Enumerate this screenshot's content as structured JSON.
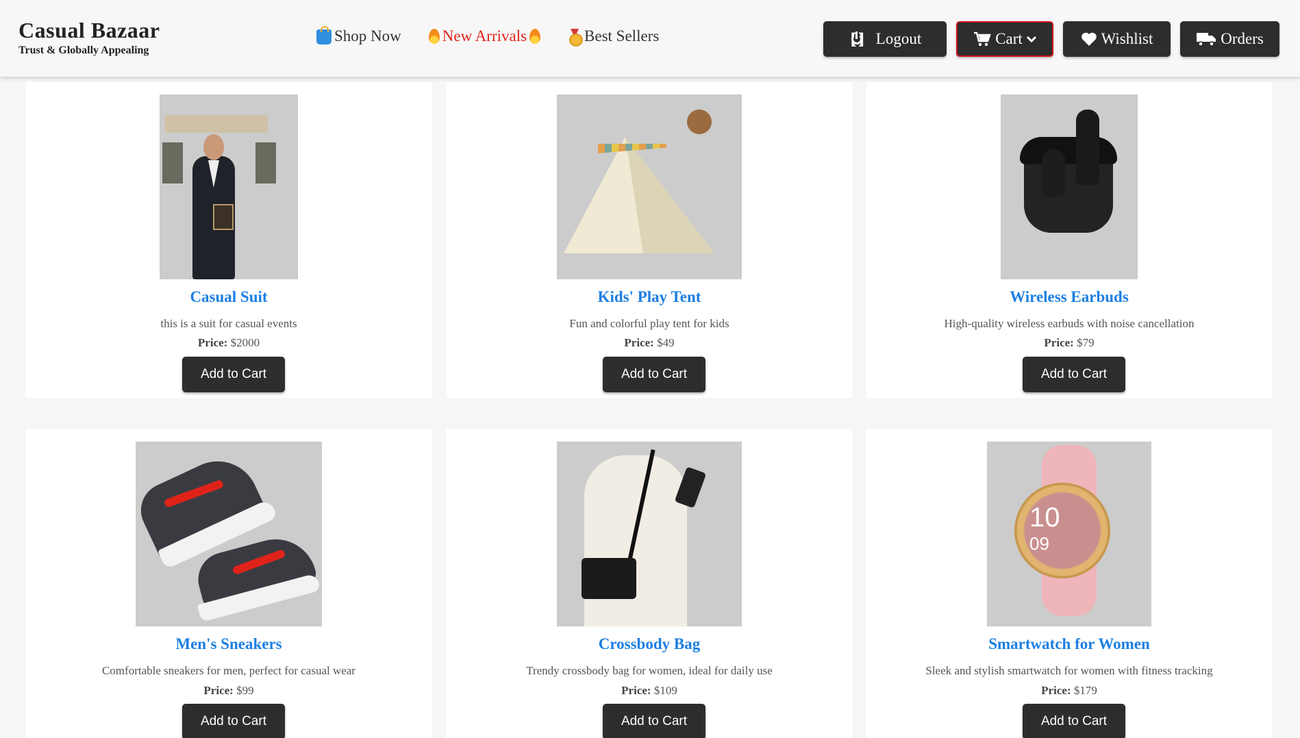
{
  "brand": {
    "title": "Casual Bazaar",
    "tagline": "Trust & Globally Appealing"
  },
  "nav": [
    {
      "label": "Shop Now",
      "icon": "shopping-bag-icon"
    },
    {
      "label": "New Arrivals",
      "icon": "fire-icon",
      "color": "#e0241a"
    },
    {
      "label": "Best Sellers",
      "icon": "medal-icon"
    }
  ],
  "actions": {
    "logout": "Logout",
    "cart": "Cart",
    "wishlist": "Wishlist",
    "orders": "Orders"
  },
  "colors": {
    "accent": "#1d7fe2",
    "button": "#2d2d2d",
    "cart_border": "#d1131b",
    "new_arrivals": "#e0241a"
  },
  "products": [
    {
      "name": "Casual Suit",
      "description": "this is a suit for casual events",
      "price_label": "Price:",
      "price": "$2000",
      "button": "Add to Cart"
    },
    {
      "name": "Kids' Play Tent",
      "description": "Fun and colorful play tent for kids",
      "price_label": "Price:",
      "price": "$49",
      "button": "Add to Cart"
    },
    {
      "name": "Wireless Earbuds",
      "description": "High-quality wireless earbuds with noise cancellation",
      "price_label": "Price:",
      "price": "$79",
      "button": "Add to Cart"
    },
    {
      "name": "Men's Sneakers",
      "description": "Comfortable sneakers for men, perfect for casual wear",
      "price_label": "Price:",
      "price": "$99",
      "button": "Add to Cart"
    },
    {
      "name": "Crossbody Bag",
      "description": "Trendy crossbody bag for women, ideal for daily use",
      "price_label": "Price:",
      "price": "$109",
      "button": "Add to Cart"
    },
    {
      "name": "Smartwatch for Women",
      "description": "Sleek and stylish smartwatch for women with fitness tracking",
      "price_label": "Price:",
      "price": "$179",
      "button": "Add to Cart"
    }
  ],
  "watch_display": {
    "time_hour": "10",
    "time_min": "09"
  }
}
